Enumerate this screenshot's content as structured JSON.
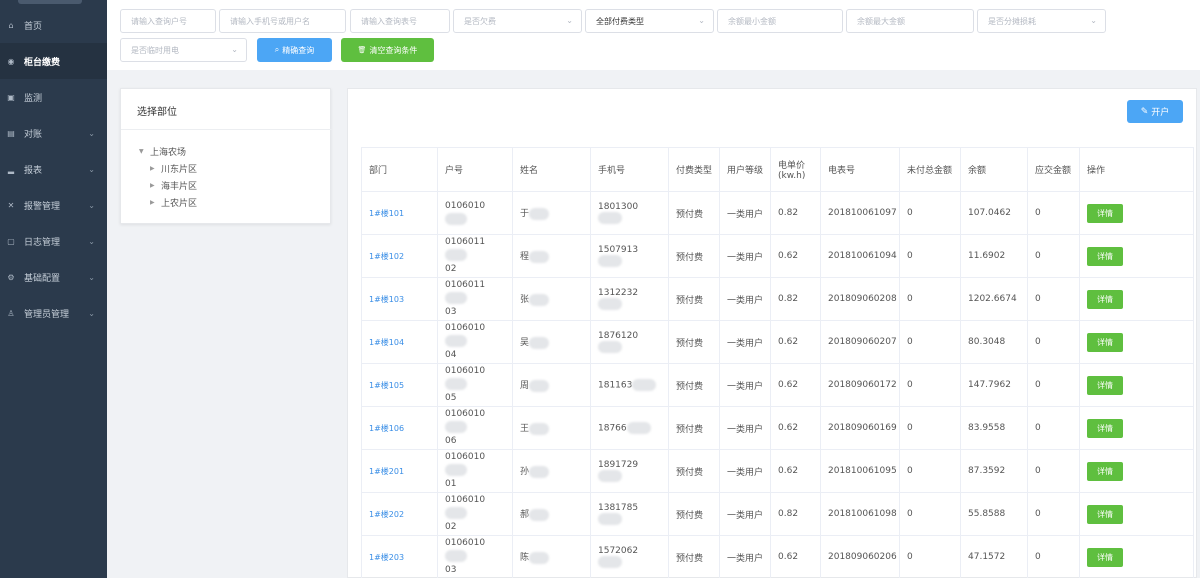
{
  "sidebar": {
    "items": [
      {
        "label": "首页",
        "icon": "home-icon",
        "glyph": "⌂",
        "expandable": false,
        "active": false
      },
      {
        "label": "柜台缴费",
        "icon": "circle-icon",
        "glyph": "◉",
        "expandable": false,
        "active": true
      },
      {
        "label": "监测",
        "icon": "monitor-icon",
        "glyph": "▣",
        "expandable": false,
        "active": false
      },
      {
        "label": "对账",
        "icon": "ledger-icon",
        "glyph": "▤",
        "expandable": true,
        "active": false
      },
      {
        "label": "报表",
        "icon": "chart-icon",
        "glyph": "▂",
        "expandable": true,
        "active": false
      },
      {
        "label": "报警管理",
        "icon": "alarm-icon",
        "glyph": "✕",
        "expandable": true,
        "active": false
      },
      {
        "label": "日志管理",
        "icon": "log-icon",
        "glyph": "▢",
        "expandable": true,
        "active": false
      },
      {
        "label": "基础配置",
        "icon": "settings-icon",
        "glyph": "⚙",
        "expandable": true,
        "active": false
      },
      {
        "label": "管理员管理",
        "icon": "admin-icon",
        "glyph": "♙",
        "expandable": true,
        "active": false
      }
    ],
    "chevron": "⌄"
  },
  "filters": {
    "account_no": "请输入查询户号",
    "phone_or_name": "请输入手机号或用户名",
    "meter_no": "请输入查询表号",
    "arrears": "是否欠费",
    "pay_type": "全部付费类型",
    "min_balance": "余额最小金额",
    "max_balance": "余额最大金额",
    "share": "是否分摊损耗",
    "temp_power": "是否临时用电",
    "caret": "⌄",
    "search_btn": "精确查询",
    "clear_btn": "清空查询条件",
    "search_icon": "⌕",
    "clear_icon": "🗑"
  },
  "tree": {
    "title": "选择部位",
    "root": "上海农场",
    "children": [
      "川东片区",
      "海丰片区",
      "上农片区"
    ],
    "arrow_open": "▼",
    "arrow_closed": "▶"
  },
  "main": {
    "open_account_btn": "开户",
    "open_icon": "✎",
    "headers": [
      "部门",
      "户号",
      "姓名",
      "手机号",
      "付费类型",
      "用户等级",
      "电单价(kw.h)",
      "电表号",
      "未付总金额",
      "余额",
      "应交金额",
      "操作"
    ],
    "detail_label": "详情",
    "rows": [
      {
        "dept": "1#楼101",
        "acct1": "0106010",
        "acct2": "",
        "name": "于",
        "phone": "1801300",
        "pay": "预付费",
        "level": "一类用户",
        "price": "0.82",
        "meter": "201810061097",
        "unpaid": "0",
        "balance": "107.0462",
        "due": "0"
      },
      {
        "dept": "1#楼102",
        "acct1": "0106011",
        "acct2": "02",
        "name": "程",
        "phone": "1507913",
        "pay": "预付费",
        "level": "一类用户",
        "price": "0.62",
        "meter": "201810061094",
        "unpaid": "0",
        "balance": "11.6902",
        "due": "0"
      },
      {
        "dept": "1#楼103",
        "acct1": "0106011",
        "acct2": "03",
        "name": "张",
        "phone": "1312232",
        "pay": "预付费",
        "level": "一类用户",
        "price": "0.82",
        "meter": "201809060208",
        "unpaid": "0",
        "balance": "1202.6674",
        "due": "0"
      },
      {
        "dept": "1#楼104",
        "acct1": "0106010",
        "acct2": "04",
        "name": "吴",
        "phone": "1876120",
        "pay": "预付费",
        "level": "一类用户",
        "price": "0.62",
        "meter": "201809060207",
        "unpaid": "0",
        "balance": "80.3048",
        "due": "0"
      },
      {
        "dept": "1#楼105",
        "acct1": "0106010",
        "acct2": "05",
        "name": "周",
        "phone": "181163",
        "pay": "预付费",
        "level": "一类用户",
        "price": "0.62",
        "meter": "201809060172",
        "unpaid": "0",
        "balance": "147.7962",
        "due": "0"
      },
      {
        "dept": "1#楼106",
        "acct1": "0106010",
        "acct2": "06",
        "name": "王",
        "phone": "18766",
        "pay": "预付费",
        "level": "一类用户",
        "price": "0.62",
        "meter": "201809060169",
        "unpaid": "0",
        "balance": "83.9558",
        "due": "0"
      },
      {
        "dept": "1#楼201",
        "acct1": "0106010",
        "acct2": "01",
        "name": "孙",
        "phone": "1891729",
        "pay": "预付费",
        "level": "一类用户",
        "price": "0.62",
        "meter": "201810061095",
        "unpaid": "0",
        "balance": "87.3592",
        "due": "0"
      },
      {
        "dept": "1#楼202",
        "acct1": "0106010",
        "acct2": "02",
        "name": "郝",
        "phone": "1381785",
        "pay": "预付费",
        "level": "一类用户",
        "price": "0.82",
        "meter": "201810061098",
        "unpaid": "0",
        "balance": "55.8588",
        "due": "0"
      },
      {
        "dept": "1#楼203",
        "acct1": "0106010",
        "acct2": "03",
        "name": "陈",
        "phone": "1572062",
        "pay": "预付费",
        "level": "一类用户",
        "price": "0.62",
        "meter": "201809060206",
        "unpaid": "0",
        "balance": "47.1572",
        "due": "0"
      }
    ]
  }
}
